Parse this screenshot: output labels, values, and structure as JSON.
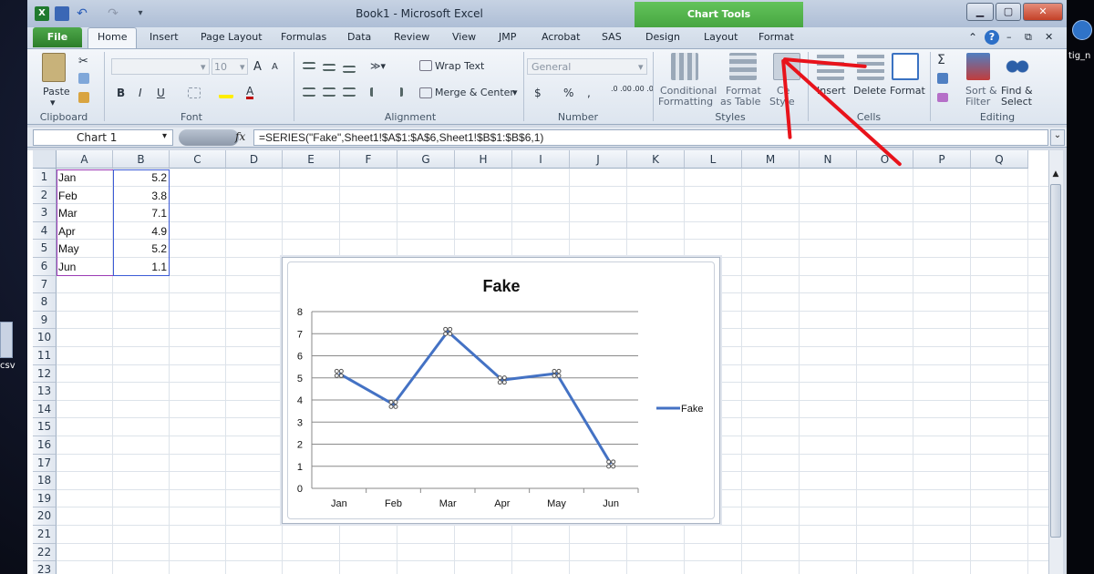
{
  "window": {
    "title": "Book1 - Microsoft Excel",
    "contextual_tab": "Chart Tools",
    "app_icon": "X"
  },
  "tabs": [
    "File",
    "Home",
    "Insert",
    "Page Layout",
    "Formulas",
    "Data",
    "Review",
    "View",
    "JMP",
    "Acrobat",
    "SAS",
    "Design",
    "Layout",
    "Format"
  ],
  "ribbon": {
    "clipboard": {
      "label": "Clipboard",
      "paste": "Paste"
    },
    "font": {
      "label": "Font",
      "size": "10",
      "bold": "B",
      "italic": "I",
      "underline": "U",
      "grow": "A",
      "shrink": "A",
      "color": "A"
    },
    "alignment": {
      "label": "Alignment",
      "wrap": "Wrap Text",
      "merge": "Merge & Center"
    },
    "number": {
      "label": "Number",
      "format": "General",
      "currency": "$",
      "percent": "%",
      "comma": ",",
      "inc": ".0 .00",
      "dec": ".00 .0"
    },
    "styles": {
      "label": "Styles",
      "cond1": "Conditional",
      "cond2": "Formatting",
      "fmt1": "Format",
      "fmt2": "as Table",
      "cell1": "Ce",
      "cell2": "Style"
    },
    "cells": {
      "label": "Cells",
      "insert": "Insert",
      "delete": "Delete",
      "format": "Format"
    },
    "editing": {
      "label": "Editing",
      "sigma": "Σ",
      "sort1": "Sort &",
      "sort2": "Filter",
      "find1": "Find &",
      "find2": "Select"
    }
  },
  "formula_bar": {
    "name_box": "Chart 1",
    "fx": "fx",
    "formula": "=SERIES(\"Fake\",Sheet1!$A$1:$A$6,Sheet1!$B$1:$B$6,1)"
  },
  "columns": [
    "A",
    "B",
    "C",
    "D",
    "E",
    "F",
    "G",
    "H",
    "I",
    "J",
    "K",
    "L",
    "M",
    "N",
    "O",
    "P",
    "Q"
  ],
  "rows": [
    "1",
    "2",
    "3",
    "4",
    "5",
    "6",
    "7",
    "8",
    "9",
    "10",
    "11",
    "12",
    "13",
    "14",
    "15",
    "16",
    "17",
    "18",
    "19",
    "20",
    "21",
    "22",
    "23"
  ],
  "cells": {
    "a": [
      "Jan",
      "Feb",
      "Mar",
      "Apr",
      "May",
      "Jun"
    ],
    "b": [
      "5.2",
      "3.8",
      "7.1",
      "4.9",
      "5.2",
      "1.1"
    ]
  },
  "chart_data": {
    "type": "line",
    "title": "Fake",
    "categories": [
      "Jan",
      "Feb",
      "Mar",
      "Apr",
      "May",
      "Jun"
    ],
    "series": [
      {
        "name": "Fake",
        "values": [
          5.2,
          3.8,
          7.1,
          4.9,
          5.2,
          1.1
        ]
      }
    ],
    "ylim": [
      0,
      8
    ],
    "yticks": [
      "0",
      "1",
      "2",
      "3",
      "4",
      "5",
      "6",
      "7",
      "8"
    ],
    "grid": true,
    "legend": "right",
    "color": "#4472C4"
  },
  "desktop": {
    "left_label": "csv",
    "right_label": "tig_n"
  }
}
